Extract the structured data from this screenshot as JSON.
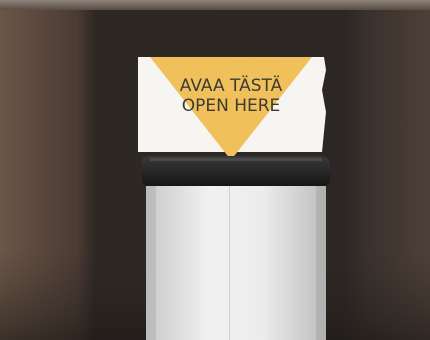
{
  "sign": {
    "line1": "AVAA TÄSTÄ",
    "line2": "OPEN HERE",
    "triangle_color": "#f0c15a",
    "card_color": "#f7f5f1"
  },
  "scene": {
    "wall_color": "#2e2824",
    "left_panel_color": "#5a4a40",
    "dispenser_color": "#e6e6e6",
    "lid_color": "#1f1f1f"
  }
}
